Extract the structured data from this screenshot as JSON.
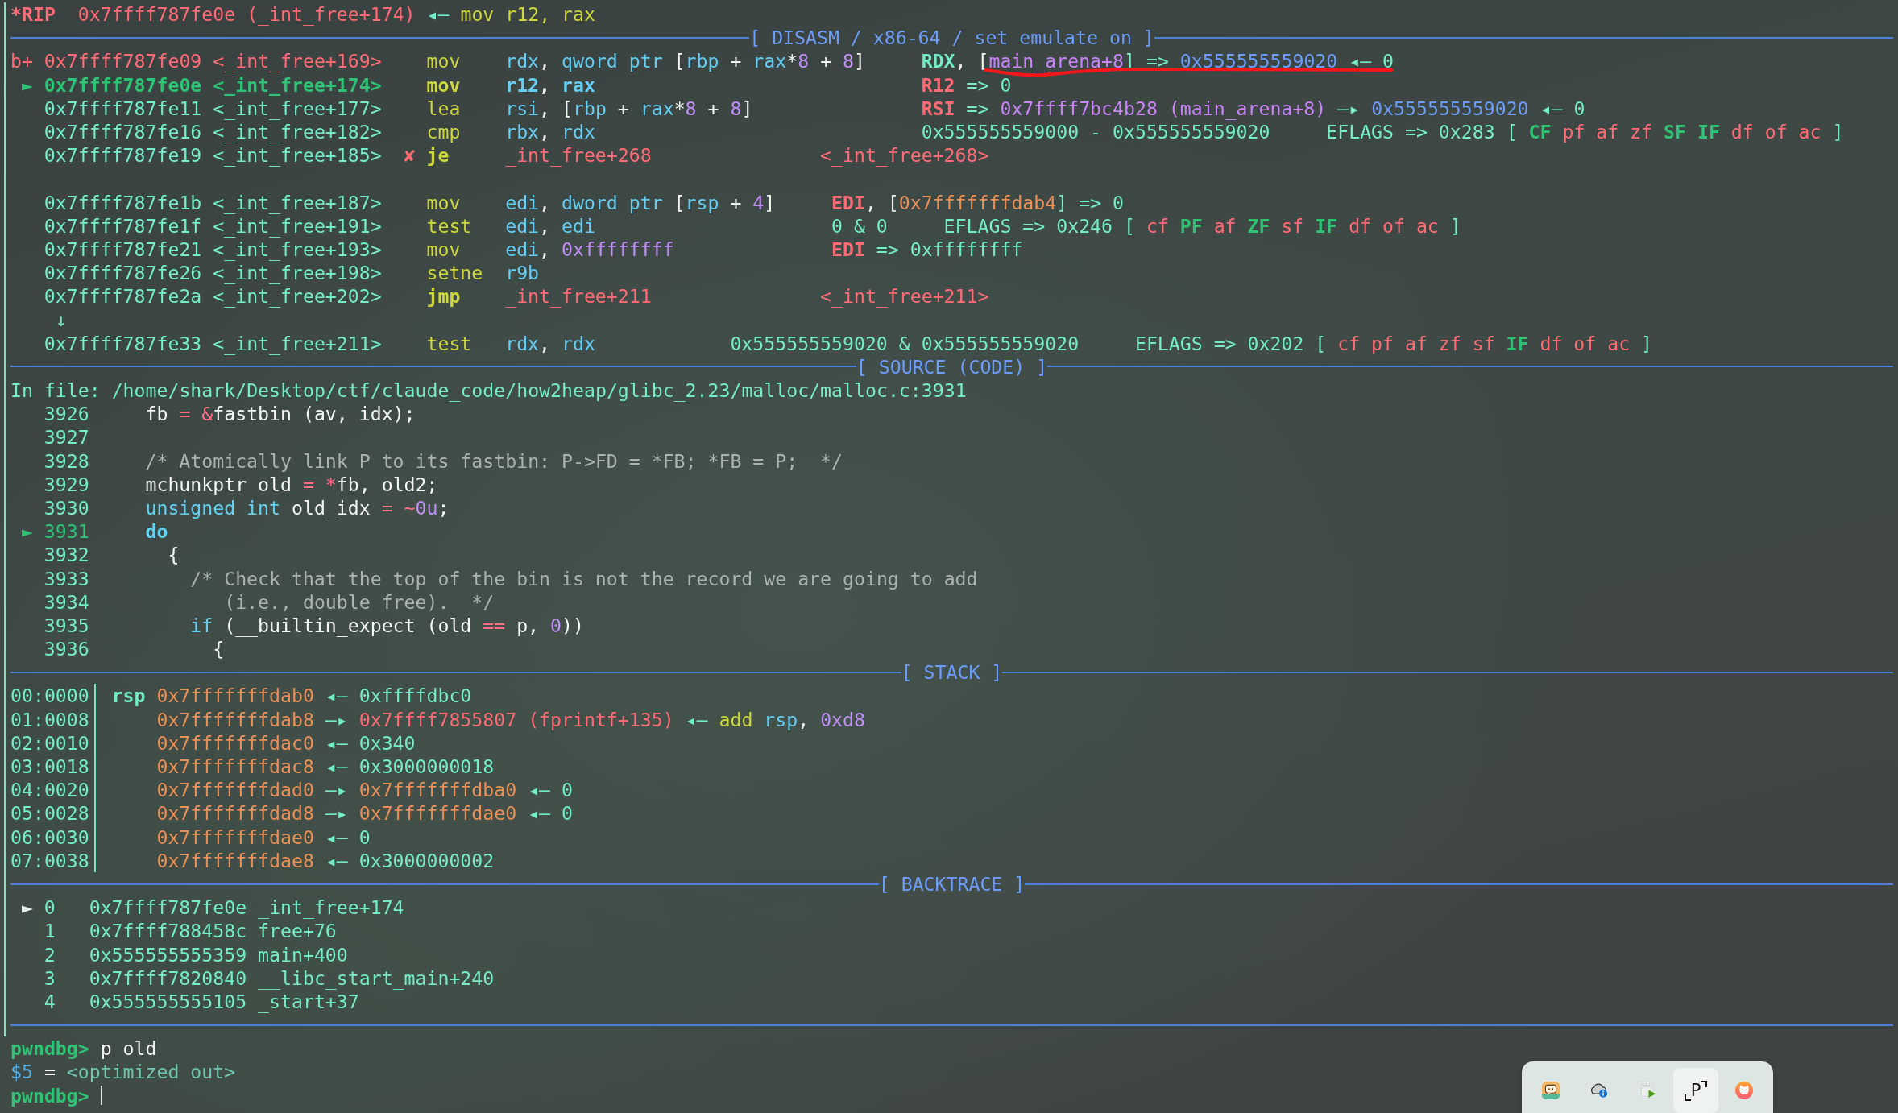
{
  "register_line": {
    "segments": [
      {
        "text": "*RIP",
        "kind": "register_changed"
      },
      {
        "text": "  0x7ffff787fe0e (_int_free+174)",
        "kind": "code"
      },
      {
        "text": " ◂— ",
        "kind": "text"
      },
      {
        "text": "mov r12, rax",
        "kind": "mnemonic"
      }
    ]
  },
  "disasm": {
    "title": "[ DISASM / x86-64 / set emulate on ]",
    "rows": [
      {
        "kind": "instruction",
        "breakpoint": true,
        "current": false,
        "marker": "b+",
        "address": "0x7ffff787fe09",
        "symbol": "<_int_free+169>",
        "mnemonic": "mov",
        "operands": [
          {
            "text": "rdx",
            "kind": "register"
          },
          {
            "text": ", ",
            "kind": "punct"
          },
          {
            "text": "qword ptr",
            "kind": "register"
          },
          {
            "text": " [",
            "kind": "punct"
          },
          {
            "text": "rbp",
            "kind": "register"
          },
          {
            "text": " + ",
            "kind": "punct"
          },
          {
            "text": "rax",
            "kind": "register"
          },
          {
            "text": "*",
            "kind": "punct"
          },
          {
            "text": "8",
            "kind": "number"
          },
          {
            "text": " + ",
            "kind": "punct"
          },
          {
            "text": "8",
            "kind": "number"
          },
          {
            "text": "]",
            "kind": "punct"
          }
        ],
        "note": [
          {
            "text": "RDX",
            "kind": "register_hint"
          },
          {
            "text": ", [",
            "kind": "punct"
          },
          {
            "text": "main_arena+8",
            "kind": "symbol"
          },
          {
            "text": "] => ",
            "kind": "text"
          },
          {
            "text": "0x555555559020",
            "kind": "heap"
          },
          {
            "text": " ◂— 0",
            "kind": "text"
          }
        ]
      },
      {
        "kind": "instruction",
        "breakpoint": false,
        "current": true,
        "marker": "►",
        "address": "0x7ffff787fe0e",
        "symbol": "<_int_free+174>",
        "mnemonic": "mov",
        "operands": [
          {
            "text": "r12",
            "kind": "register"
          },
          {
            "text": ", ",
            "kind": "punct"
          },
          {
            "text": "rax",
            "kind": "register"
          }
        ],
        "note": [
          {
            "text": "R12",
            "kind": "register_changed"
          },
          {
            "text": " => 0",
            "kind": "text"
          }
        ]
      },
      {
        "kind": "instruction",
        "breakpoint": false,
        "current": false,
        "address": "0x7ffff787fe11",
        "symbol": "<_int_free+177>",
        "mnemonic": "lea",
        "operands": [
          {
            "text": "rsi",
            "kind": "register"
          },
          {
            "text": ", [",
            "kind": "punct"
          },
          {
            "text": "rbp",
            "kind": "register"
          },
          {
            "text": " + ",
            "kind": "punct"
          },
          {
            "text": "rax",
            "kind": "register"
          },
          {
            "text": "*",
            "kind": "punct"
          },
          {
            "text": "8",
            "kind": "number"
          },
          {
            "text": " + ",
            "kind": "punct"
          },
          {
            "text": "8",
            "kind": "number"
          },
          {
            "text": "]",
            "kind": "punct"
          }
        ],
        "note": [
          {
            "text": "RSI",
            "kind": "register_changed"
          },
          {
            "text": " => ",
            "kind": "text"
          },
          {
            "text": "0x7ffff7bc4b28 (main_arena+8)",
            "kind": "symbol"
          },
          {
            "text": " —▸ ",
            "kind": "text"
          },
          {
            "text": "0x555555559020",
            "kind": "heap"
          },
          {
            "text": " ◂— 0",
            "kind": "text"
          }
        ]
      },
      {
        "kind": "instruction",
        "breakpoint": false,
        "current": false,
        "address": "0x7ffff787fe16",
        "symbol": "<_int_free+182>",
        "mnemonic": "cmp",
        "operands": [
          {
            "text": "rbx",
            "kind": "register"
          },
          {
            "text": ", ",
            "kind": "punct"
          },
          {
            "text": "rdx",
            "kind": "register"
          }
        ],
        "note": [
          {
            "text": "0x555555559000 - 0x555555559020     EFLAGS => 0x283 [",
            "kind": "text"
          },
          {
            "text": "CF",
            "kind": "flag",
            "set": true
          },
          {
            "text": "pf",
            "kind": "flag",
            "set": false
          },
          {
            "text": "af",
            "kind": "flag",
            "set": false
          },
          {
            "text": "zf",
            "kind": "flag",
            "set": false
          },
          {
            "text": "SF",
            "kind": "flag",
            "set": true
          },
          {
            "text": "IF",
            "kind": "flag",
            "set": true
          },
          {
            "text": "df",
            "kind": "flag",
            "set": false
          },
          {
            "text": "of",
            "kind": "flag",
            "set": false
          },
          {
            "text": "ac",
            "kind": "flag",
            "set": false
          },
          {
            "text": "]",
            "kind": "text"
          }
        ]
      },
      {
        "kind": "branch",
        "breakpoint": false,
        "current": false,
        "branch_mark": "✘",
        "address": "0x7ffff787fe19",
        "symbol": "<_int_free+185>",
        "mnemonic": "je",
        "operands": [
          {
            "text": "_int_free+268",
            "kind": "code"
          }
        ],
        "note": [
          {
            "text": "<_int_free+268>",
            "kind": "code"
          }
        ]
      },
      {
        "kind": "gap"
      },
      {
        "kind": "instruction",
        "breakpoint": false,
        "current": false,
        "address": "0x7ffff787fe1b",
        "symbol": "<_int_free+187>",
        "mnemonic": "mov",
        "operands": [
          {
            "text": "edi",
            "kind": "register"
          },
          {
            "text": ", ",
            "kind": "punct"
          },
          {
            "text": "dword ptr",
            "kind": "register"
          },
          {
            "text": " [",
            "kind": "punct"
          },
          {
            "text": "rsp",
            "kind": "register"
          },
          {
            "text": " + ",
            "kind": "punct"
          },
          {
            "text": "4",
            "kind": "number"
          },
          {
            "text": "]",
            "kind": "punct"
          }
        ],
        "note": [
          {
            "text": "EDI",
            "kind": "register_changed"
          },
          {
            "text": ", [",
            "kind": "punct"
          },
          {
            "text": "0x7fffffffdab4",
            "kind": "stack"
          },
          {
            "text": "] => 0",
            "kind": "text"
          }
        ]
      },
      {
        "kind": "instruction",
        "breakpoint": false,
        "current": false,
        "address": "0x7ffff787fe1f",
        "symbol": "<_int_free+191>",
        "mnemonic": "test",
        "operands": [
          {
            "text": "edi",
            "kind": "register"
          },
          {
            "text": ", ",
            "kind": "punct"
          },
          {
            "text": "edi",
            "kind": "register"
          }
        ],
        "note": [
          {
            "text": "0 & 0     EFLAGS => 0x246 [",
            "kind": "text"
          },
          {
            "text": "cf",
            "kind": "flag",
            "set": false
          },
          {
            "text": "PF",
            "kind": "flag",
            "set": true
          },
          {
            "text": "af",
            "kind": "flag",
            "set": false
          },
          {
            "text": "ZF",
            "kind": "flag",
            "set": true
          },
          {
            "text": "sf",
            "kind": "flag",
            "set": false
          },
          {
            "text": "IF",
            "kind": "flag",
            "set": true
          },
          {
            "text": "df",
            "kind": "flag",
            "set": false
          },
          {
            "text": "of",
            "kind": "flag",
            "set": false
          },
          {
            "text": "ac",
            "kind": "flag",
            "set": false
          },
          {
            "text": "]",
            "kind": "text"
          }
        ]
      },
      {
        "kind": "instruction",
        "breakpoint": false,
        "current": false,
        "address": "0x7ffff787fe21",
        "symbol": "<_int_free+193>",
        "mnemonic": "mov",
        "operands": [
          {
            "text": "edi",
            "kind": "register"
          },
          {
            "text": ", ",
            "kind": "punct"
          },
          {
            "text": "0xffffffff",
            "kind": "number"
          }
        ],
        "note": [
          {
            "text": "EDI",
            "kind": "register_changed"
          },
          {
            "text": " => 0xffffffff",
            "kind": "text"
          }
        ]
      },
      {
        "kind": "instruction",
        "breakpoint": false,
        "current": false,
        "address": "0x7ffff787fe26",
        "symbol": "<_int_free+198>",
        "mnemonic": "setne",
        "operands": [
          {
            "text": "r9b",
            "kind": "register"
          }
        ]
      },
      {
        "kind": "branch",
        "breakpoint": false,
        "current": false,
        "address": "0x7ffff787fe2a",
        "symbol": "<_int_free+202>",
        "mnemonic": "jmp",
        "operands": [
          {
            "text": "_int_free+211",
            "kind": "code"
          }
        ],
        "note": [
          {
            "text": "<_int_free+211>",
            "kind": "code"
          }
        ]
      },
      {
        "kind": "jump_arrow",
        "arrow": "↓"
      },
      {
        "kind": "instruction",
        "breakpoint": false,
        "current": false,
        "address": "0x7ffff787fe33",
        "symbol": "<_int_free+211>",
        "mnemonic": "test",
        "operands": [
          {
            "text": "rdx",
            "kind": "register"
          },
          {
            "text": ", ",
            "kind": "punct"
          },
          {
            "text": "rdx",
            "kind": "register"
          }
        ],
        "note": [
          {
            "text": "0x555555559020 & 0x555555559020     EFLAGS => 0x202 [",
            "kind": "text"
          },
          {
            "text": "cf",
            "kind": "flag",
            "set": false
          },
          {
            "text": "pf",
            "kind": "flag",
            "set": false
          },
          {
            "text": "af",
            "kind": "flag",
            "set": false
          },
          {
            "text": "zf",
            "kind": "flag",
            "set": false
          },
          {
            "text": "sf",
            "kind": "flag",
            "set": false
          },
          {
            "text": "IF",
            "kind": "flag",
            "set": true
          },
          {
            "text": "df",
            "kind": "flag",
            "set": false
          },
          {
            "text": "of",
            "kind": "flag",
            "set": false
          },
          {
            "text": "ac",
            "kind": "flag",
            "set": false
          },
          {
            "text": "]",
            "kind": "text"
          }
        ]
      }
    ]
  },
  "source": {
    "title": "[ SOURCE (CODE) ]",
    "file": "In file: /home/shark/Desktop/ctf/claude_code/how2heap/glibc_2.23/malloc/malloc.c:3931",
    "lines": [
      {
        "number": "3926",
        "current": false,
        "code": [
          {
            "text": "fb ",
            "kind": "plain"
          },
          {
            "text": "= &",
            "kind": "operator"
          },
          {
            "text": "fastbin (av, idx);",
            "kind": "plain"
          }
        ]
      },
      {
        "number": "3927",
        "current": false
      },
      {
        "number": "3928",
        "current": false,
        "code": [
          {
            "text": "/* Atomically link P to its fastbin: P->FD = *FB; *FB = P;  */",
            "kind": "comment"
          }
        ]
      },
      {
        "number": "3929",
        "current": false,
        "code": [
          {
            "text": "mchunkptr old ",
            "kind": "plain"
          },
          {
            "text": "= *",
            "kind": "operator"
          },
          {
            "text": "fb, old2;",
            "kind": "plain"
          }
        ]
      },
      {
        "number": "3930",
        "current": false,
        "code": [
          {
            "text": "unsigned int",
            "kind": "keyword"
          },
          {
            "text": " old_idx ",
            "kind": "plain"
          },
          {
            "text": "= ~",
            "kind": "operator"
          },
          {
            "text": "0u",
            "kind": "number"
          },
          {
            "text": ";",
            "kind": "plain"
          }
        ]
      },
      {
        "number": "3931",
        "current": true,
        "marker": "►",
        "code": [
          {
            "text": "do",
            "kind": "keyword_strong"
          }
        ]
      },
      {
        "number": "3932",
        "current": false,
        "code": [
          {
            "text": "  {",
            "kind": "plain"
          }
        ]
      },
      {
        "number": "3933",
        "current": false,
        "code": [
          {
            "text": "    /* Check that the top of the bin is not the record we are going to add",
            "kind": "comment"
          }
        ]
      },
      {
        "number": "3934",
        "current": false,
        "code": [
          {
            "text": "       (i.e., double free).  */",
            "kind": "comment"
          }
        ]
      },
      {
        "number": "3935",
        "current": false,
        "code": [
          {
            "text": "    if",
            "kind": "keyword"
          },
          {
            "text": " (__builtin_expect (old ",
            "kind": "plain"
          },
          {
            "text": "==",
            "kind": "operator"
          },
          {
            "text": " p, ",
            "kind": "plain"
          },
          {
            "text": "0",
            "kind": "number"
          },
          {
            "text": "))",
            "kind": "plain"
          }
        ]
      },
      {
        "number": "3936",
        "current": false,
        "code": [
          {
            "text": "      {",
            "kind": "plain"
          }
        ]
      }
    ]
  },
  "stack": {
    "title": "[ STACK ]",
    "rows": [
      {
        "offset": "00:0000",
        "register": "rsp",
        "address": "0x7fffffffdab0",
        "value": [
          {
            "text": "◂— 0xffffdbc0",
            "kind": "text"
          }
        ]
      },
      {
        "offset": "01:0008",
        "address": "0x7fffffffdab8",
        "value": [
          {
            "text": "—▸ ",
            "kind": "text"
          },
          {
            "text": "0x7ffff7855807 (fprintf+135)",
            "kind": "code"
          },
          {
            "text": " ◂— ",
            "kind": "text"
          },
          {
            "text": "add",
            "kind": "mnemonic"
          },
          {
            "text": " rsp",
            "kind": "register"
          },
          {
            "text": ", ",
            "kind": "punct"
          },
          {
            "text": "0xd8",
            "kind": "number"
          }
        ]
      },
      {
        "offset": "02:0010",
        "address": "0x7fffffffdac0",
        "value": [
          {
            "text": "◂— 0x340",
            "kind": "text"
          }
        ]
      },
      {
        "offset": "03:0018",
        "address": "0x7fffffffdac8",
        "value": [
          {
            "text": "◂— 0x3000000018",
            "kind": "text"
          }
        ]
      },
      {
        "offset": "04:0020",
        "address": "0x7fffffffdad0",
        "value": [
          {
            "text": "—▸ ",
            "kind": "text"
          },
          {
            "text": "0x7fffffffdba0",
            "kind": "stack"
          },
          {
            "text": " ◂— 0",
            "kind": "text"
          }
        ]
      },
      {
        "offset": "05:0028",
        "address": "0x7fffffffdad8",
        "value": [
          {
            "text": "—▸ ",
            "kind": "text"
          },
          {
            "text": "0x7fffffffdae0",
            "kind": "stack"
          },
          {
            "text": " ◂— 0",
            "kind": "text"
          }
        ]
      },
      {
        "offset": "06:0030",
        "address": "0x7fffffffdae0",
        "value": [
          {
            "text": "◂— 0",
            "kind": "text"
          }
        ]
      },
      {
        "offset": "07:0038",
        "address": "0x7fffffffdae8",
        "value": [
          {
            "text": "◂— 0x3000000002",
            "kind": "text"
          }
        ]
      }
    ]
  },
  "backtrace": {
    "title": "[ BACKTRACE ]",
    "frames": [
      {
        "marker": "►",
        "number": "0",
        "address": "0x7ffff787fe0e",
        "symbol": "_int_free+174"
      },
      {
        "number": "1",
        "address": "0x7ffff788458c",
        "symbol": "free+76"
      },
      {
        "number": "2",
        "address": "0x555555555359",
        "symbol": "main+400"
      },
      {
        "number": "3",
        "address": "0x7ffff7820840",
        "symbol": "__libc_start_main+240"
      },
      {
        "number": "4",
        "address": "0x555555555105",
        "symbol": "_start+37"
      }
    ]
  },
  "console": {
    "lines": [
      {
        "segments": [
          {
            "text": "pwndbg>",
            "kind": "prompt"
          },
          {
            "text": " p old",
            "kind": "plain"
          }
        ]
      },
      {
        "segments": [
          {
            "text": "$5",
            "kind": "history"
          },
          {
            "text": " = ",
            "kind": "plain"
          },
          {
            "text": "<optimized out>",
            "kind": "dim"
          }
        ]
      }
    ],
    "input": {
      "prompt": "pwndbg>"
    }
  },
  "tray": {
    "items": [
      {
        "kind": "chat",
        "selected": false
      },
      {
        "kind": "cloud",
        "selected": false
      },
      {
        "kind": "media",
        "selected": false
      },
      {
        "kind": "capture",
        "selected": true,
        "glyph": "P"
      },
      {
        "kind": "cat",
        "selected": false
      }
    ]
  }
}
